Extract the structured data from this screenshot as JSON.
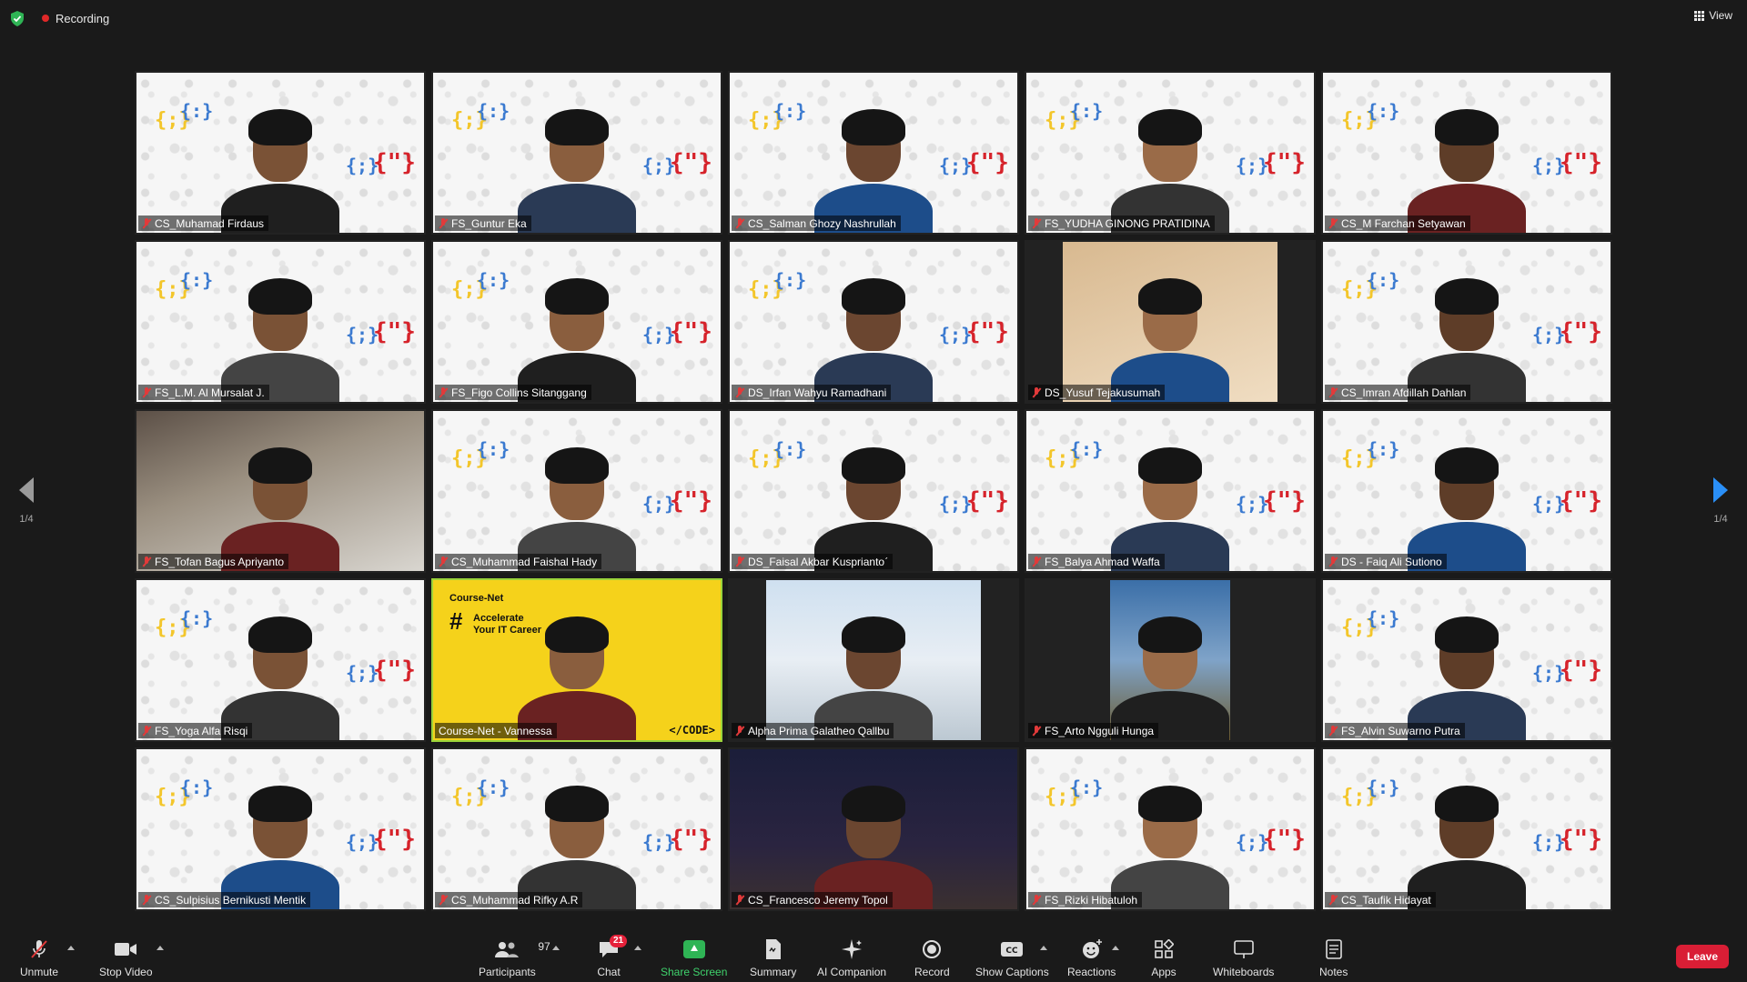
{
  "top": {
    "recording_label": "Recording",
    "view_label": "View"
  },
  "pagination": {
    "left_page": "1/4",
    "right_page": "1/4"
  },
  "tiles": [
    {
      "name": "CS_Muhamad Firdaus",
      "bg": "pattern",
      "muted": true
    },
    {
      "name": "FS_Guntur Eka",
      "bg": "pattern",
      "muted": true
    },
    {
      "name": "CS_Salman Ghozy Nashrullah",
      "bg": "pattern",
      "muted": true
    },
    {
      "name": "FS_YUDHA GINONG PRATIDINA",
      "bg": "pattern",
      "muted": true
    },
    {
      "name": "CS_M Farchan Setyawan",
      "bg": "pattern",
      "muted": true
    },
    {
      "name": "FS_L.M. Al Mursalat J.",
      "bg": "pattern",
      "muted": true
    },
    {
      "name": "FS_Figo Collins Sitanggang",
      "bg": "pattern",
      "muted": true
    },
    {
      "name": "DS_Irfan Wahyu Ramadhani",
      "bg": "pattern",
      "muted": true
    },
    {
      "name": "DS_Yusuf Tejakusumah",
      "bg": "wall2",
      "muted": true
    },
    {
      "name": "CS_Imran Afdillah Dahlan",
      "bg": "pattern",
      "muted": true
    },
    {
      "name": "FS_Tofan Bagus Apriyanto",
      "bg": "room",
      "muted": true
    },
    {
      "name": "CS_Muhammad Faishal Hady",
      "bg": "pattern",
      "muted": true
    },
    {
      "name": "DS_Faisal Akbar Kuspriantoˊ",
      "bg": "pattern",
      "muted": true
    },
    {
      "name": "FS_Balya Ahmad Waffa",
      "bg": "pattern",
      "muted": true
    },
    {
      "name": "DS - Faiq Ali Sutiono",
      "bg": "pattern",
      "muted": true
    },
    {
      "name": "FS_Yoga Alfa Risqi",
      "bg": "pattern",
      "muted": true
    },
    {
      "name": "Course-Net - Vannessa",
      "bg": "yellow",
      "muted": false,
      "speaking": true
    },
    {
      "name": "Alpha Prima Galatheo Qallbu",
      "bg": "mall",
      "muted": true
    },
    {
      "name": "FS_Arto Ngguli Hunga",
      "bg": "blue",
      "muted": true
    },
    {
      "name": "FS_Alvin Suwarno Putra",
      "bg": "pattern",
      "muted": true
    },
    {
      "name": "CS_Sulpisius Bernikusti Mentik",
      "bg": "pattern",
      "muted": true
    },
    {
      "name": "CS_Muhammad Rifky A.R",
      "bg": "pattern",
      "muted": true
    },
    {
      "name": "CS_Francesco Jeremy Topol",
      "bg": "dark",
      "muted": true
    },
    {
      "name": "FS_Rizki Hibatuloh",
      "bg": "pattern",
      "muted": true
    },
    {
      "name": "CS_Taufik Hidayat",
      "bg": "pattern",
      "muted": true
    }
  ],
  "course_card": {
    "line1": "Accelerate",
    "line2": "Your IT Career",
    "hash": "#",
    "brand": "Course-Net",
    "code": "</CODE>"
  },
  "toolbar": {
    "unmute": "Unmute",
    "stop_video": "Stop Video",
    "participants": "Participants",
    "participants_count": "97",
    "chat": "Chat",
    "chat_badge": "21",
    "share_screen": "Share Screen",
    "summary": "Summary",
    "ai_companion": "AI Companion",
    "record": "Record",
    "show_captions": "Show Captions",
    "reactions": "Reactions",
    "apps": "Apps",
    "whiteboards": "Whiteboards",
    "notes": "Notes",
    "leave": "Leave"
  },
  "colors": {
    "accent_green": "#2fb455",
    "leave_red": "#d91e35",
    "speaking_border": "#9bd33a",
    "arrow_blue": "#2a8ff7"
  }
}
